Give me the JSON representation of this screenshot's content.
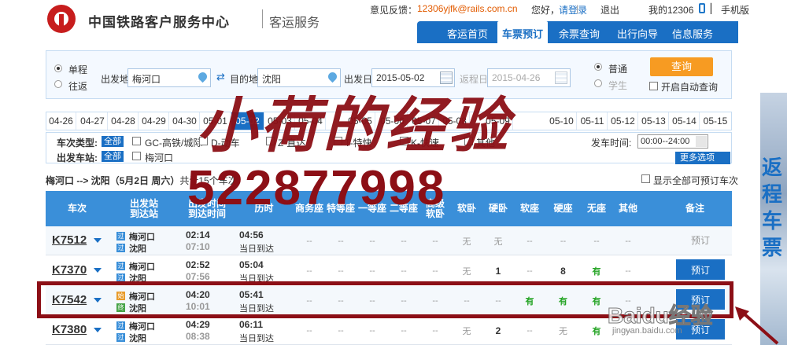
{
  "header": {
    "brand": "中国铁路客户服务中心",
    "brand_sub": "客运服务",
    "feedback_label": "意见反馈：",
    "feedback_email": "12306yjfk@rails.com.cn",
    "greeting": "您好，",
    "login": "请登录",
    "logout": "退出",
    "my12306": "我的12306",
    "mobile": "手机版"
  },
  "nav": {
    "items": [
      "客运首页",
      "车票预订",
      "余票查询",
      "出行向导",
      "信息服务"
    ],
    "active": "车票预订"
  },
  "search": {
    "trip_one_way": "单程",
    "trip_round": "往返",
    "from_label": "出发地",
    "from_value": "梅河口",
    "to_label": "目的地",
    "to_value": "沈阳",
    "depart_label": "出发日",
    "depart_value": "2015-05-02",
    "return_label": "返程日",
    "return_value": "2015-04-26",
    "type_normal": "普通",
    "type_student": "学生",
    "query_button": "查询",
    "auto_query": "开启自动查询"
  },
  "date_tabs": [
    "04-26",
    "04-27",
    "04-28",
    "04-29",
    "04-30",
    "05-01",
    "05-02",
    "05-03",
    "05-04",
    "05-05",
    "05-06",
    "05-07",
    "05-08",
    "05-09",
    "05-10",
    "05-11",
    "05-12",
    "05-13",
    "05-14",
    "05-15"
  ],
  "filters": {
    "train_type_label": "车次类型:",
    "station_label": "出发车站:",
    "all_tag": "全部",
    "types": [
      "GC-高铁/城际",
      "D-动车",
      "Z-直达",
      "T-特快",
      "K-快速",
      "其他"
    ],
    "station": "梅河口",
    "depart_time_label": "发车时间:",
    "depart_time_value": "00:00--24:00",
    "more_options": "更多选项"
  },
  "route_info": {
    "text": "梅河口 --> 沈阳（5月2日 周六）",
    "count": "共计15个车次",
    "show_all": "显示全部可预订车次"
  },
  "table": {
    "headers": [
      "车次",
      "出发站\n到达站",
      "出发时间\n到达时间",
      "历时",
      "商务座",
      "特等座",
      "一等座",
      "二等座",
      "高级\n软卧",
      "软卧",
      "硬卧",
      "软座",
      "硬座",
      "无座",
      "其他",
      "备注"
    ],
    "rows": [
      {
        "train": "K7512",
        "from": "梅河口",
        "to": "沈阳",
        "dep": "02:14",
        "dur": "07:10",
        "arr": "04:56",
        "day": "当日到达",
        "seats": [
          "--",
          "--",
          "--",
          "--",
          "--",
          "无",
          "无",
          "--",
          "--",
          "--",
          "--"
        ],
        "book": "预订",
        "bookable": false
      },
      {
        "train": "K7370",
        "from": "梅河口",
        "to": "沈阳",
        "dep": "02:52",
        "dur": "07:56",
        "arr": "05:04",
        "day": "当日到达",
        "seats": [
          "--",
          "--",
          "--",
          "--",
          "--",
          "无",
          "1",
          "--",
          "8",
          "有",
          "--"
        ],
        "book": "预订",
        "bookable": true
      },
      {
        "train": "K7542",
        "from": "梅河口",
        "to": "沈阳",
        "dep": "04:20",
        "dur": "10:01",
        "arr": "05:41",
        "day": "当日到达",
        "seats": [
          "--",
          "--",
          "--",
          "--",
          "--",
          "--",
          "--",
          "有",
          "有",
          "有",
          "--"
        ],
        "book": "预订",
        "bookable": true
      },
      {
        "train": "K7380",
        "from": "梅河口",
        "to": "沈阳",
        "dep": "04:29",
        "dur": "08:38",
        "arr": "06:11",
        "day": "当日到达",
        "seats": [
          "--",
          "--",
          "--",
          "--",
          "--",
          "无",
          "2",
          "--",
          "无",
          "有",
          "--"
        ],
        "book": "预订",
        "bookable": true
      }
    ]
  },
  "overlay": {
    "title": "小荷的经验",
    "number": "522877998",
    "baidu": "Baidu经验",
    "baidu_sub": "jingyan.baidu.com"
  },
  "side_ad": {
    "text": "返程车票"
  }
}
